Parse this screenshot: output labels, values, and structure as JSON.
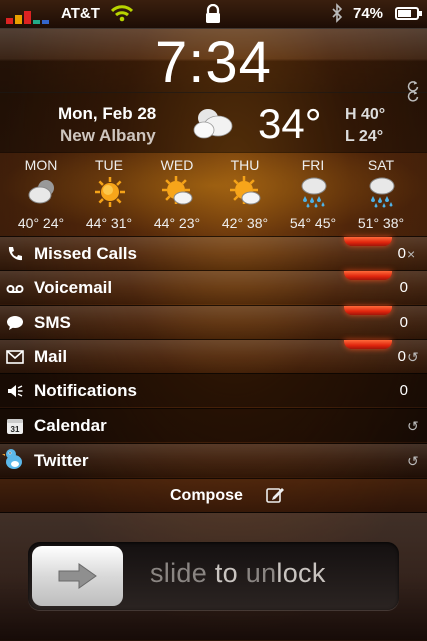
{
  "status_bar": {
    "carrier": "AT&T",
    "battery_pct": "74%",
    "battery_level": 0.74
  },
  "lock_screen": {
    "time": "7:34"
  },
  "current_weather": {
    "date": "Mon, Feb 28",
    "city": "New Albany",
    "condition_icon": "partly-cloudy-icon",
    "temp": "34°",
    "high": "H 40°",
    "low": "L 24°"
  },
  "forecast": [
    {
      "day": "MON",
      "icon": "cloudy-moon-icon",
      "temps": "40° 24°"
    },
    {
      "day": "TUE",
      "icon": "sun-icon",
      "temps": "44° 31°"
    },
    {
      "day": "WED",
      "icon": "sun-cloud-icon",
      "temps": "44° 23°"
    },
    {
      "day": "THU",
      "icon": "sun-cloud-icon",
      "temps": "42° 38°"
    },
    {
      "day": "FRI",
      "icon": "rain-icon",
      "temps": "54° 45°"
    },
    {
      "day": "SAT",
      "icon": "rain-icon",
      "temps": "51° 38°"
    }
  ],
  "notifications": [
    {
      "label": "Missed Calls",
      "count": "0",
      "action": "×",
      "icon": "phone-icon"
    },
    {
      "label": "Voicemail",
      "count": "0",
      "icon": "voicemail-icon"
    },
    {
      "label": "SMS",
      "count": "0",
      "icon": "speech-bubble-icon"
    },
    {
      "label": "Mail",
      "count": "0",
      "action": "↺",
      "icon": "envelope-icon"
    },
    {
      "label": "Notifications",
      "count": "0",
      "icon": "speaker-icon"
    },
    {
      "label": "Calendar",
      "action": "↺",
      "icon": "calendar-icon",
      "calendar_day": "31"
    },
    {
      "label": "Twitter",
      "action": "↺",
      "icon": "twitter-bird-icon"
    }
  ],
  "compose": {
    "label": "Compose"
  },
  "unlock": {
    "text_a": "slide ",
    "text_b": "to",
    "text_c": " un",
    "text_d": "lock"
  },
  "colors": {
    "accent_red": "#e0250d",
    "sun": "#f5a318",
    "rain": "#4fb3e8"
  }
}
